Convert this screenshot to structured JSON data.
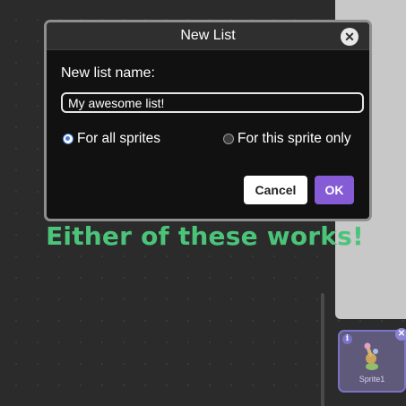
{
  "dialog": {
    "title": "New List",
    "close_icon": "close-icon",
    "field_label": "New list name:",
    "list_name_value": "My awesome list!",
    "scope_options": [
      {
        "label": "For all sprites",
        "checked": true
      },
      {
        "label": "For this sprite only",
        "checked": false
      }
    ],
    "cancel_label": "Cancel",
    "ok_label": "OK"
  },
  "annotation": {
    "text": "Either of these works!"
  },
  "sprite_pane": {
    "sprite_name": "Sprite1",
    "info_icon": "info-icon",
    "delete_icon": "delete-icon"
  },
  "colors": {
    "accent": "#855cd6",
    "annotation": "#4bc47a",
    "dialog_bg": "#111111",
    "stage_bg": "#2b2b2b"
  }
}
